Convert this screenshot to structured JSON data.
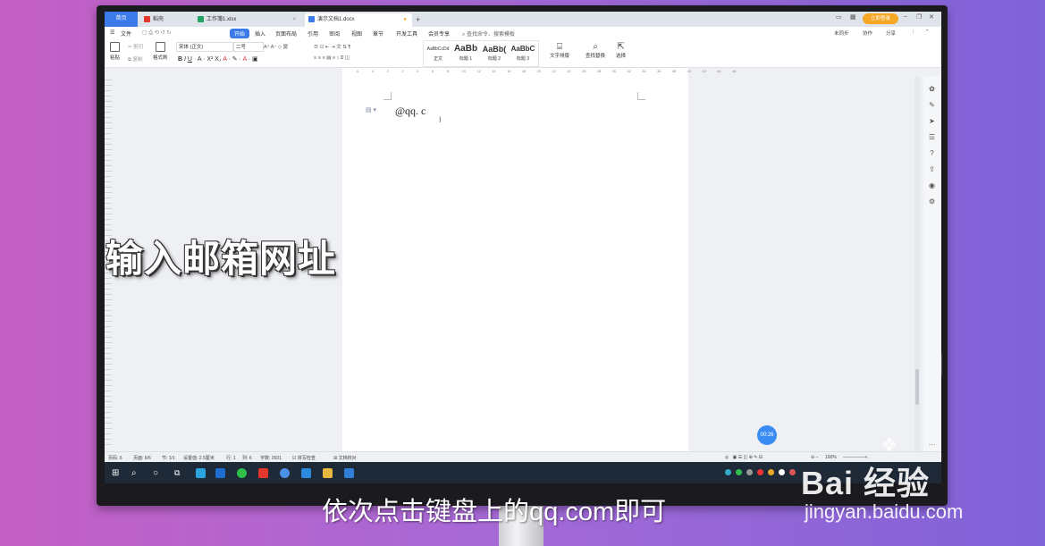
{
  "tabs": [
    {
      "label": "首页"
    },
    {
      "label": "稻壳"
    },
    {
      "label": "工作簿1.xlsx"
    },
    {
      "label": "演示文档1.docx"
    }
  ],
  "titlebar": {
    "login_label": "立即登录"
  },
  "menu": {
    "file": "文件",
    "items": [
      "开始",
      "插入",
      "页面布局",
      "引用",
      "审阅",
      "视图",
      "章节",
      "开发工具",
      "会员专享"
    ],
    "search_placeholder": "查找命令、搜索模板",
    "right": [
      "未同步",
      "协作",
      "分享"
    ]
  },
  "ribbon": {
    "paste": "粘贴",
    "cut": "剪切",
    "copy": "复制",
    "format_painter": "格式刷",
    "font": "宋体 (正文)",
    "font_size": "二号",
    "styles": [
      {
        "preview": "AaBbCcDd",
        "label": "正文"
      },
      {
        "preview": "AaBb",
        "label": "标题 1"
      },
      {
        "preview": "AaBb(",
        "label": "标题 2"
      },
      {
        "preview": "AaBbC",
        "label": "标题 3"
      }
    ],
    "text_layout": "文字排版",
    "find_replace": "查找替换",
    "select": "选择"
  },
  "ruler": [
    "6",
    "4",
    "2",
    "2",
    "4",
    "6",
    "8",
    "10",
    "12",
    "14",
    "16",
    "18",
    "20",
    "22",
    "24",
    "26",
    "28",
    "30",
    "32",
    "34",
    "36",
    "38",
    "40",
    "42",
    "44",
    "46"
  ],
  "document": {
    "text": "@qq. c"
  },
  "timer": "00:26",
  "status": {
    "page": "页码: 6",
    "pages": "页面: 6/6",
    "section": "节: 1/1",
    "setting": "设置值: 2.5厘米",
    "row": "行: 1",
    "col": "列: 6",
    "words": "字数: 2601",
    "spell": "拼写检查",
    "proof": "文档校对",
    "zoom": "100%"
  },
  "overlay": {
    "title": "输入邮箱网址",
    "subtitle": "依次点击键盘上的qq.com即可"
  },
  "watermark": {
    "logo": "Bai 经验",
    "url": "jingyan.baidu.com"
  }
}
